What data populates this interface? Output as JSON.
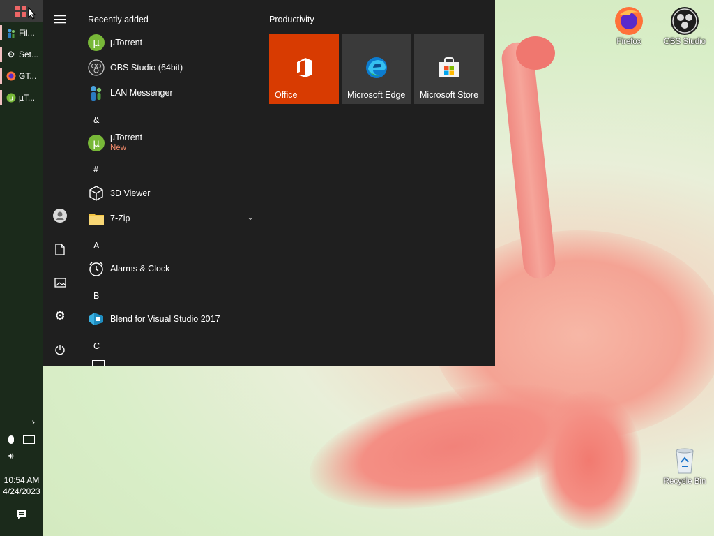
{
  "taskbar": {
    "items": [
      {
        "label": "Fil...",
        "icon": "lan-messenger-icon"
      },
      {
        "label": "Set...",
        "icon": "gear-icon"
      },
      {
        "label": "GT...",
        "icon": "firefox-icon"
      },
      {
        "label": "µT...",
        "icon": "utorrent-icon"
      }
    ],
    "time": "10:54 AM",
    "date": "4/24/2023"
  },
  "start_menu": {
    "recently_added_header": "Recently added",
    "recent": [
      {
        "name": "µTorrent",
        "icon": "utorrent-icon"
      },
      {
        "name": "OBS Studio (64bit)",
        "icon": "obs-icon"
      },
      {
        "name": "LAN Messenger",
        "icon": "lan-messenger-icon"
      }
    ],
    "groups": [
      {
        "letter": "&",
        "apps": [
          {
            "name": "µTorrent",
            "badge": "New",
            "icon": "utorrent-icon"
          }
        ]
      },
      {
        "letter": "#",
        "apps": [
          {
            "name": "3D Viewer",
            "icon": "cube-icon"
          },
          {
            "name": "7-Zip",
            "icon": "folder-icon"
          }
        ]
      },
      {
        "letter": "A",
        "apps": [
          {
            "name": "Alarms & Clock",
            "icon": "clock-icon"
          }
        ]
      },
      {
        "letter": "B",
        "apps": [
          {
            "name": "Blend for Visual Studio 2017",
            "icon": "blend-icon"
          }
        ]
      },
      {
        "letter": "C",
        "apps": []
      }
    ],
    "tiles_header": "Productivity",
    "tiles": [
      {
        "label": "Office",
        "color": "#d83b01",
        "icon": "office-icon"
      },
      {
        "label": "Microsoft Edge",
        "color": "#3a3a3a",
        "icon": "edge-icon"
      },
      {
        "label": "Microsoft Store",
        "color": "#3a3a3a",
        "icon": "store-icon"
      }
    ]
  },
  "desktop": {
    "icons": [
      {
        "label": "Firefox",
        "icon": "firefox-icon"
      },
      {
        "label": "OBS Studio",
        "icon": "obs-icon"
      },
      {
        "label": "Recycle Bin",
        "icon": "recycle-bin-icon"
      }
    ]
  }
}
